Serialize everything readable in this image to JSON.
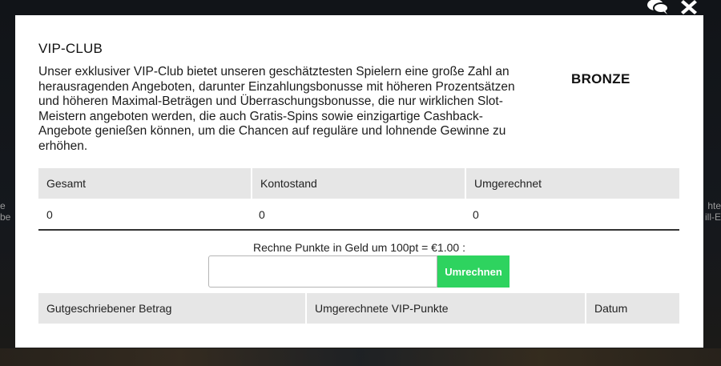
{
  "backdrop": {
    "left_text": "e\nbe",
    "right_text": "hte\nill-E"
  },
  "icons": {
    "chat": "chat-bubbles-icon",
    "close": "close-icon"
  },
  "modal": {
    "title": "VIP-CLUB",
    "description": "Unser exklusiver VIP-Club bietet unseren geschätztesten Spielern eine große Zahl an herausragenden Angeboten, darunter Einzahlungsbonusse mit höheren Prozentsätzen und höheren Maximal-Beträgen und Überraschungsbonusse, die nur wirklichen Slot-Meistern angeboten werden, die auch Gratis-Spins sowie einzigartige Cashback-Angebote genießen können, um die Chancen auf reguläre und lohnende Gewinne zu erhöhen.",
    "level": "BRONZE"
  },
  "stats": {
    "headers": [
      "Gesamt",
      "Kontostand",
      "Umgerechnet"
    ],
    "values": [
      "0",
      "0",
      "0"
    ]
  },
  "convert": {
    "label": "Rechne Punkte in Geld um 100pt = €1.00 :",
    "input_value": "",
    "input_placeholder": "",
    "button_label": "Umrechnen"
  },
  "history": {
    "headers": [
      "Gutgeschriebener Betrag",
      "Umgerechnete VIP-Punkte",
      "Datum"
    ]
  },
  "colors": {
    "accent": "#2ed35f",
    "header_bg": "#e6e6e6"
  }
}
